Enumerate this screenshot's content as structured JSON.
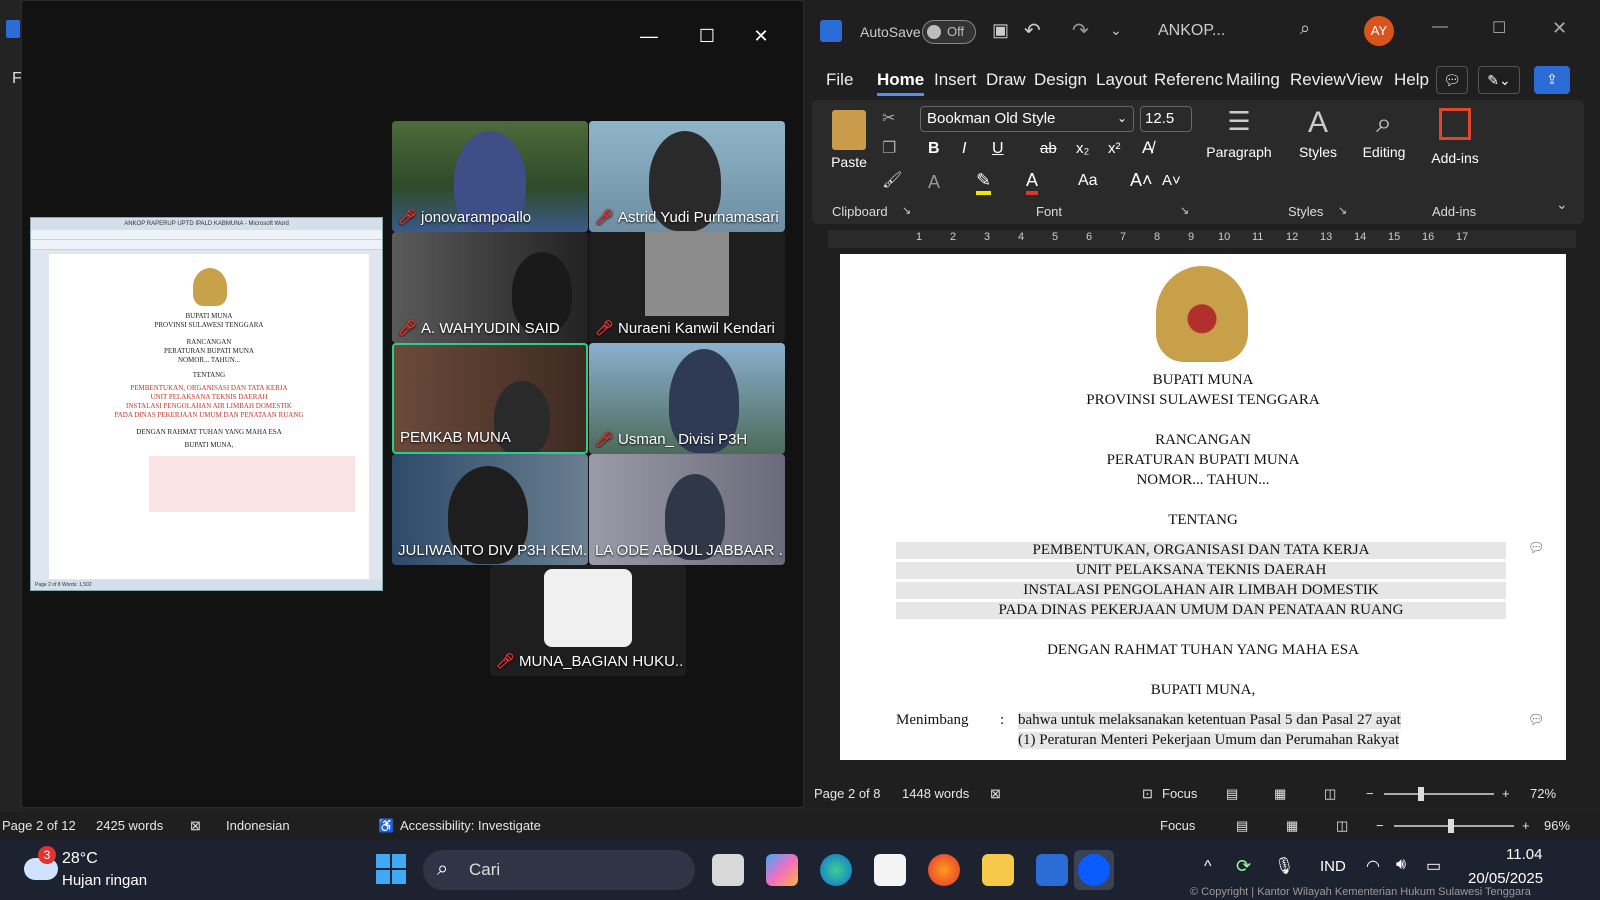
{
  "bg_word": {
    "file_menu": "F",
    "status": {
      "page": "Page 2 of 12",
      "words": "2425 words",
      "language": "Indonesian",
      "accessibility": "Accessibility: Investigate",
      "focus": "Focus",
      "zoom": "96%"
    }
  },
  "zoom": {
    "participants": [
      {
        "name": "jonovarampoallo",
        "muted": true
      },
      {
        "name": "Astrid Yudi Purnamasari",
        "muted": true
      },
      {
        "name": "A. WAHYUDIN SAID",
        "muted": true
      },
      {
        "name": "Nuraeni Kanwil Kendari",
        "muted": true
      },
      {
        "name": "PEMKAB MUNA",
        "muted": false,
        "active": true
      },
      {
        "name": "Usman_ Divisi P3H",
        "muted": true
      },
      {
        "name": "JULIWANTO DIV P3H KEM...",
        "muted": false
      },
      {
        "name": "LA ODE ABDUL JABBAAR ...",
        "muted": false
      },
      {
        "name": "MUNA_BAGIAN HUKU...",
        "muted": true
      }
    ],
    "shared_doc": {
      "title": "ANKOP RAPERUP UPTD IPALD KABMUNA - Microsoft Word",
      "lines": [
        "BUPATI MUNA",
        "PROVINSI SULAWESI TENGGARA",
        "RANCANGAN",
        "PERATURAN BUPATI MUNA",
        "NOMOR... TAHUN...",
        "TENTANG"
      ],
      "red_lines": [
        "PEMBENTUKAN, ORGANISASI DAN TATA KERJA",
        "UNIT PELAKSANA TEKNIS DAERAH",
        "INSTALASI PENGOLAHAN AIR LIMBAH DOMESTIK",
        "PADA DINAS PEKERJAAN UMUM DAN PENATAAN RUANG"
      ],
      "lines2": [
        "DENGAN RAHMAT TUHAN YANG MAHA ESA",
        "BUPATI MUNA,"
      ],
      "status": "Page 2 of 8   Words: 1,502"
    }
  },
  "word": {
    "autosave_label": "AutoSave",
    "autosave_state": "Off",
    "doc_title": "ANKOP...",
    "avatar": "AY",
    "menu": [
      "File",
      "Home",
      "Insert",
      "Draw",
      "Design",
      "Layout",
      "Referenc",
      "Mailing",
      "Review",
      "View",
      "Help"
    ],
    "font_name": "Bookman Old Style",
    "font_size": "12.5",
    "groups": {
      "clipboard": "Clipboard",
      "font": "Font",
      "styles": "Styles",
      "addins": "Add-ins"
    },
    "buttons": {
      "paste": "Paste",
      "paragraph": "Paragraph",
      "styles": "Styles",
      "editing": "Editing",
      "addins": "Add-ins"
    },
    "ruler": [
      "1",
      "2",
      "3",
      "4",
      "5",
      "6",
      "7",
      "8",
      "9",
      "10",
      "11",
      "12",
      "13",
      "14",
      "15",
      "16",
      "17"
    ],
    "doc": {
      "l1": "BUPATI MUNA",
      "l2": "PROVINSI SULAWESI TENGGARA",
      "l3": "RANCANGAN",
      "l4": "PERATURAN BUPATI MUNA",
      "l5": "NOMOR... TAHUN...",
      "l6": "TENTANG",
      "h1": "PEMBENTUKAN, ORGANISASI DAN TATA KERJA",
      "h2": "UNIT PELAKSANA TEKNIS DAERAH",
      "h3": "INSTALASI PENGOLAHAN AIR LIMBAH DOMESTIK",
      "h4": "PADA DINAS PEKERJAAN UMUM DAN PENATAAN RUANG",
      "l7": "DENGAN RAHMAT TUHAN YANG MAHA ESA",
      "l8": "BUPATI MUNA,",
      "menimbang_label": "Menimbang",
      "menimbang_colon": ":",
      "menimbang_text1": "bahwa untuk melaksanakan ketentuan Pasal 5 dan Pasal 27 ayat",
      "menimbang_text2": "(1) Peraturan Menteri Pekerjaan Umum dan Perumahan Rakyat"
    },
    "status": {
      "page": "Page 2 of 8",
      "words": "1448 words",
      "focus": "Focus",
      "zoom": "72%"
    }
  },
  "taskbar": {
    "weather_temp": "28°C",
    "weather_desc": "Hujan ringan",
    "weather_badge": "3",
    "search_placeholder": "Cari",
    "lang": "IND",
    "time": "11.04",
    "date": "20/05/2025",
    "watermark": "© Copyright | Kantor Wilayah Kementerian Hukum Sulawesi Tenggara"
  }
}
